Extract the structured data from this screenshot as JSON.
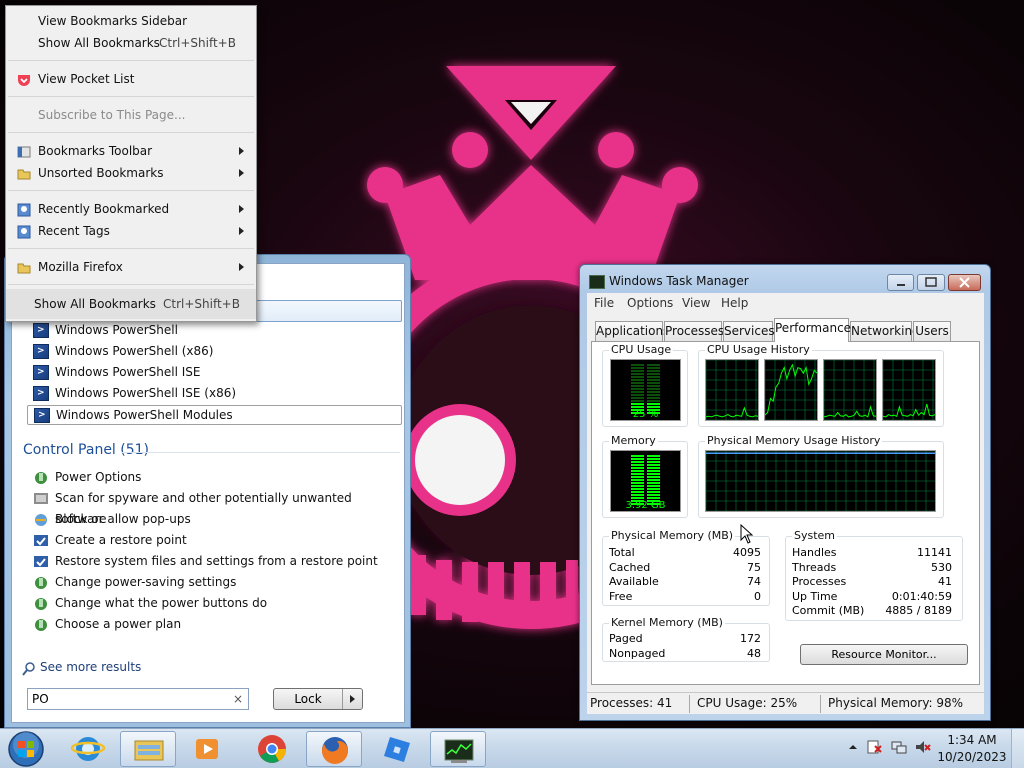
{
  "bookmarks_menu": {
    "items": [
      {
        "label": "View Bookmarks Sidebar",
        "shortcut": "",
        "icon": "none"
      },
      {
        "label": "Show All Bookmarks",
        "shortcut": "Ctrl+Shift+B",
        "icon": "none"
      },
      {
        "label": "View Pocket List",
        "shortcut": "",
        "icon": "pocket-icon"
      },
      {
        "label": "Subscribe to This Page...",
        "shortcut": "",
        "icon": "none",
        "disabled": true
      },
      {
        "label": "Bookmarks Toolbar",
        "shortcut": "",
        "icon": "toolbar-icon",
        "submenu": true
      },
      {
        "label": "Unsorted Bookmarks",
        "shortcut": "",
        "icon": "folder-icon",
        "submenu": true
      },
      {
        "label": "Recently Bookmarked",
        "shortcut": "",
        "icon": "bookmark-query-icon",
        "submenu": true
      },
      {
        "label": "Recent Tags",
        "shortcut": "",
        "icon": "bookmark-query-icon",
        "submenu": true
      },
      {
        "label": "Mozilla Firefox",
        "shortcut": "",
        "icon": "folder-icon",
        "submenu": true
      },
      {
        "label": "Show All Bookmarks",
        "shortcut": "Ctrl+Shift+B",
        "icon": "none"
      }
    ]
  },
  "start_menu": {
    "programs": [
      {
        "label": "Windows PowerShell",
        "icon": "powershell-icon"
      },
      {
        "label": "Windows PowerShell (x86)",
        "icon": "powershell-icon"
      },
      {
        "label": "Windows PowerShell ISE",
        "icon": "powershell-icon"
      },
      {
        "label": "Windows PowerShell ISE (x86)",
        "icon": "powershell-icon"
      },
      {
        "label": "Windows PowerShell Modules",
        "icon": "powershell-icon",
        "selected": true
      }
    ],
    "control_panel_header": "Control Panel (51)",
    "control_panel_items": [
      {
        "label": "Power Options",
        "icon": "power-options-icon"
      },
      {
        "label": "Scan for spyware and other potentially unwanted software",
        "icon": "defender-icon"
      },
      {
        "label": "Block or allow pop-ups",
        "icon": "internet-options-icon"
      },
      {
        "label": "Create a restore point",
        "icon": "system-icon"
      },
      {
        "label": "Restore system files and settings from a restore point",
        "icon": "system-icon"
      },
      {
        "label": "Change power-saving settings",
        "icon": "power-options-icon"
      },
      {
        "label": "Change what the power buttons do",
        "icon": "power-options-icon"
      },
      {
        "label": "Choose a power plan",
        "icon": "power-options-icon"
      }
    ],
    "see_more": "See more results",
    "search_value": "PO",
    "search_clear": "×",
    "lock_label": "Lock"
  },
  "task_manager": {
    "title": "Windows Task Manager",
    "menu": [
      "File",
      "Options",
      "View",
      "Help"
    ],
    "tabs": [
      "Applications",
      "Processes",
      "Services",
      "Performance",
      "Networking",
      "Users"
    ],
    "active_tab": "Performance",
    "cpu_usage_title": "CPU Usage",
    "cpu_usage_value": "25 %",
    "cpu_usage_fraction": 0.25,
    "cpu_history_title": "CPU Usage History",
    "memory_title": "Memory",
    "memory_value": "3.92 GB",
    "memory_fraction": 0.98,
    "memory_history_title": "Physical Memory Usage History",
    "physical_memory": {
      "title": "Physical Memory (MB)",
      "rows": [
        {
          "k": "Total",
          "v": "4095"
        },
        {
          "k": "Cached",
          "v": "75"
        },
        {
          "k": "Available",
          "v": "74"
        },
        {
          "k": "Free",
          "v": "0"
        }
      ]
    },
    "kernel_memory": {
      "title": "Kernel Memory (MB)",
      "rows": [
        {
          "k": "Paged",
          "v": "172"
        },
        {
          "k": "Nonpaged",
          "v": "48"
        }
      ]
    },
    "system": {
      "title": "System",
      "rows": [
        {
          "k": "Handles",
          "v": "11141"
        },
        {
          "k": "Threads",
          "v": "530"
        },
        {
          "k": "Processes",
          "v": "41"
        },
        {
          "k": "Up Time",
          "v": "0:01:40:59"
        },
        {
          "k": "Commit (MB)",
          "v": "4885 / 8189"
        }
      ]
    },
    "resource_monitor_label": "Resource Monitor...",
    "status": {
      "processes": "Processes: 41",
      "cpu": "CPU Usage: 25%",
      "memory": "Physical Memory: 98%"
    }
  },
  "taskbar": {
    "pinned": [
      "internet-explorer-icon",
      "windows-explorer-icon",
      "media-player-icon",
      "chrome-icon",
      "firefox-icon",
      "roblox-icon",
      "task-manager-icon"
    ],
    "clock_time": "1:34 AM",
    "clock_date": "10/20/2023"
  },
  "colors": {
    "wallpaper_pink": "#e8338a",
    "graph_green": "#00ff00",
    "grid_green": "#007f3f",
    "link_blue": "#1e4f9a"
  }
}
